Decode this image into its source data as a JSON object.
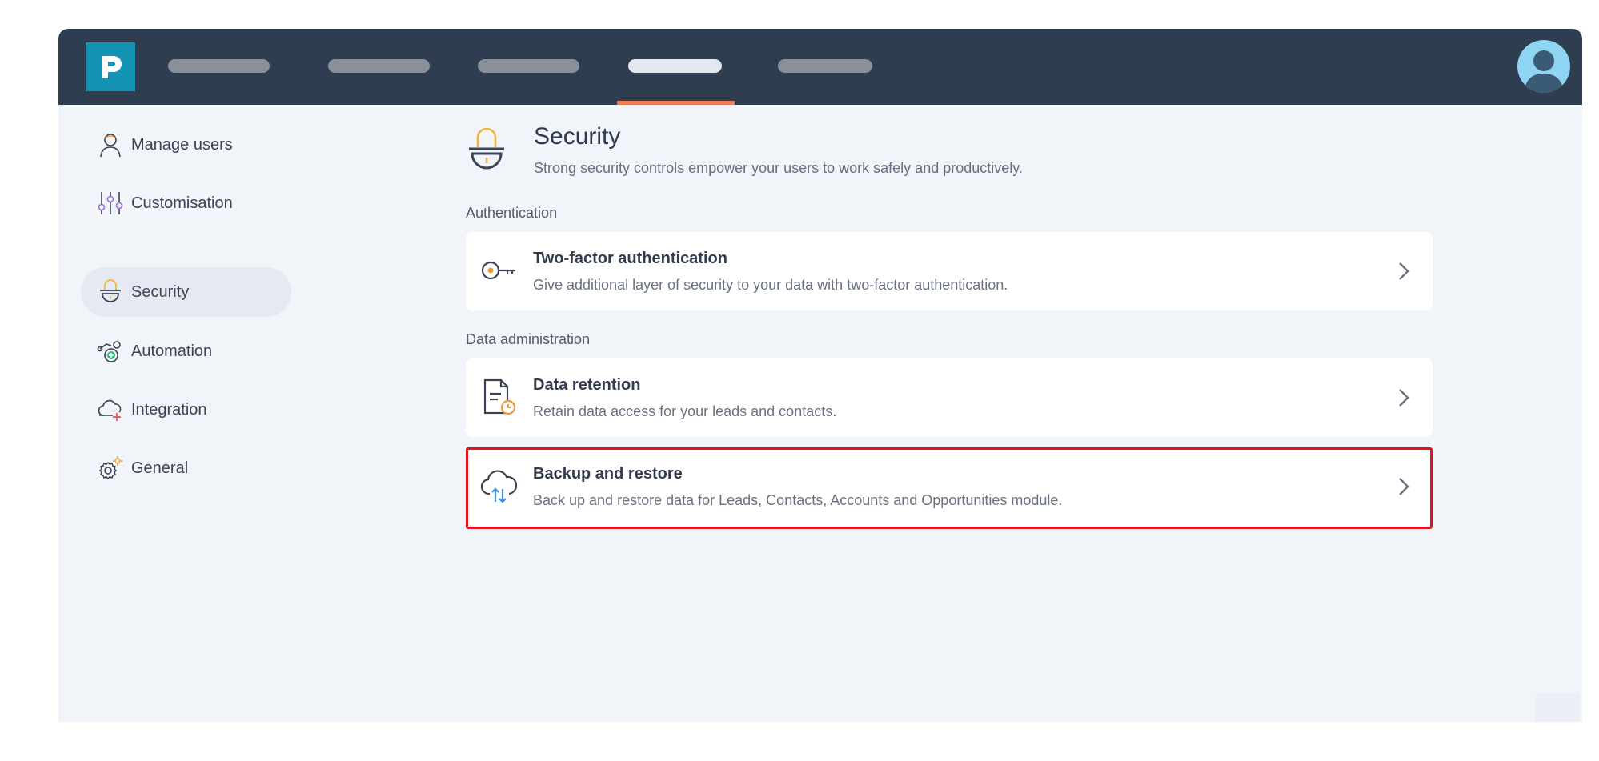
{
  "topbar": {
    "logo_letter": "p",
    "nav_items": [
      {
        "label": "",
        "state": "inactive"
      },
      {
        "label": "",
        "state": "inactive"
      },
      {
        "label": "",
        "state": "inactive"
      },
      {
        "label": "",
        "state": "active"
      },
      {
        "label": "",
        "state": "inactive"
      }
    ],
    "active_underline_color": "#ef7a57",
    "bar_color": "#2e3d4f",
    "logo_color": "#1493b5"
  },
  "sidebar": {
    "items": [
      {
        "label": "Manage users",
        "icon": "manage-users-icon",
        "active": false
      },
      {
        "label": "Customisation",
        "icon": "sliders-icon",
        "active": false
      },
      {
        "label": "Security",
        "icon": "padlock-icon",
        "active": true
      },
      {
        "label": "Automation",
        "icon": "automation-icon",
        "active": false
      },
      {
        "label": "Integration",
        "icon": "cloud-plus-icon",
        "active": false
      },
      {
        "label": "General",
        "icon": "gear-icon",
        "active": false
      }
    ]
  },
  "main": {
    "title": "Security",
    "subtitle": "Strong security controls empower your users to work safely and productively.",
    "groups": [
      {
        "heading": "Authentication",
        "cards": [
          {
            "title": "Two-factor authentication",
            "description": "Give additional layer of security to your data with two-factor authentication.",
            "icon": "key-icon",
            "highlighted": false
          }
        ]
      },
      {
        "heading": "Data administration",
        "cards": [
          {
            "title": "Data retention",
            "description": "Retain data access for your leads and contacts.",
            "icon": "document-clock-icon",
            "highlighted": false
          },
          {
            "title": "Backup and restore",
            "description": "Back up and restore data for Leads, Contacts, Accounts and Opportunities module.",
            "icon": "cloud-sync-icon",
            "highlighted": true
          }
        ]
      }
    ]
  },
  "colors": {
    "highlight_border": "#e3121d",
    "accent_orange": "#f09a3e",
    "page_background": "#f1f4f8"
  }
}
